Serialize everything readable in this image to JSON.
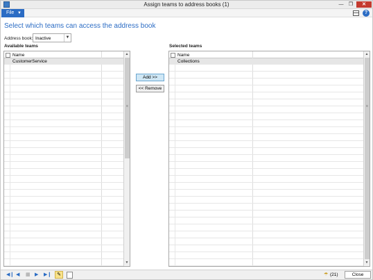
{
  "window": {
    "title": "Assign teams to address books (1)"
  },
  "menu": {
    "file_label": "File"
  },
  "heading": "Select which teams can access the address book",
  "address_book": {
    "label": "Address book:",
    "value": "Inactive"
  },
  "available": {
    "title": "Available teams",
    "column": "Name",
    "rows": [
      "CustomerService"
    ]
  },
  "selected": {
    "title": "Selected teams",
    "column": "Name",
    "rows": [
      "Collections"
    ]
  },
  "buttons": {
    "add": "Add >>",
    "remove": "<< Remove"
  },
  "status": {
    "notification_count": "(21)",
    "close": "Close"
  },
  "icons": {
    "app": "app-icon",
    "minimize": "minimize-icon",
    "maximize": "maximize-icon",
    "close": "close-icon",
    "layout": "layout-icon",
    "help": "help-icon",
    "dropdown": "chevron-down-icon",
    "first": "first-record-icon",
    "prev": "previous-record-icon",
    "grid": "grid-view-icon",
    "next": "next-record-icon",
    "last": "last-record-icon",
    "edit": "edit-pencil-icon",
    "attach": "attachment-icon",
    "bell": "notification-bell-icon"
  },
  "colors": {
    "accent": "#2b6cc4",
    "selected_row": "#e6e6e6",
    "add_button": "#cfe7f5"
  }
}
